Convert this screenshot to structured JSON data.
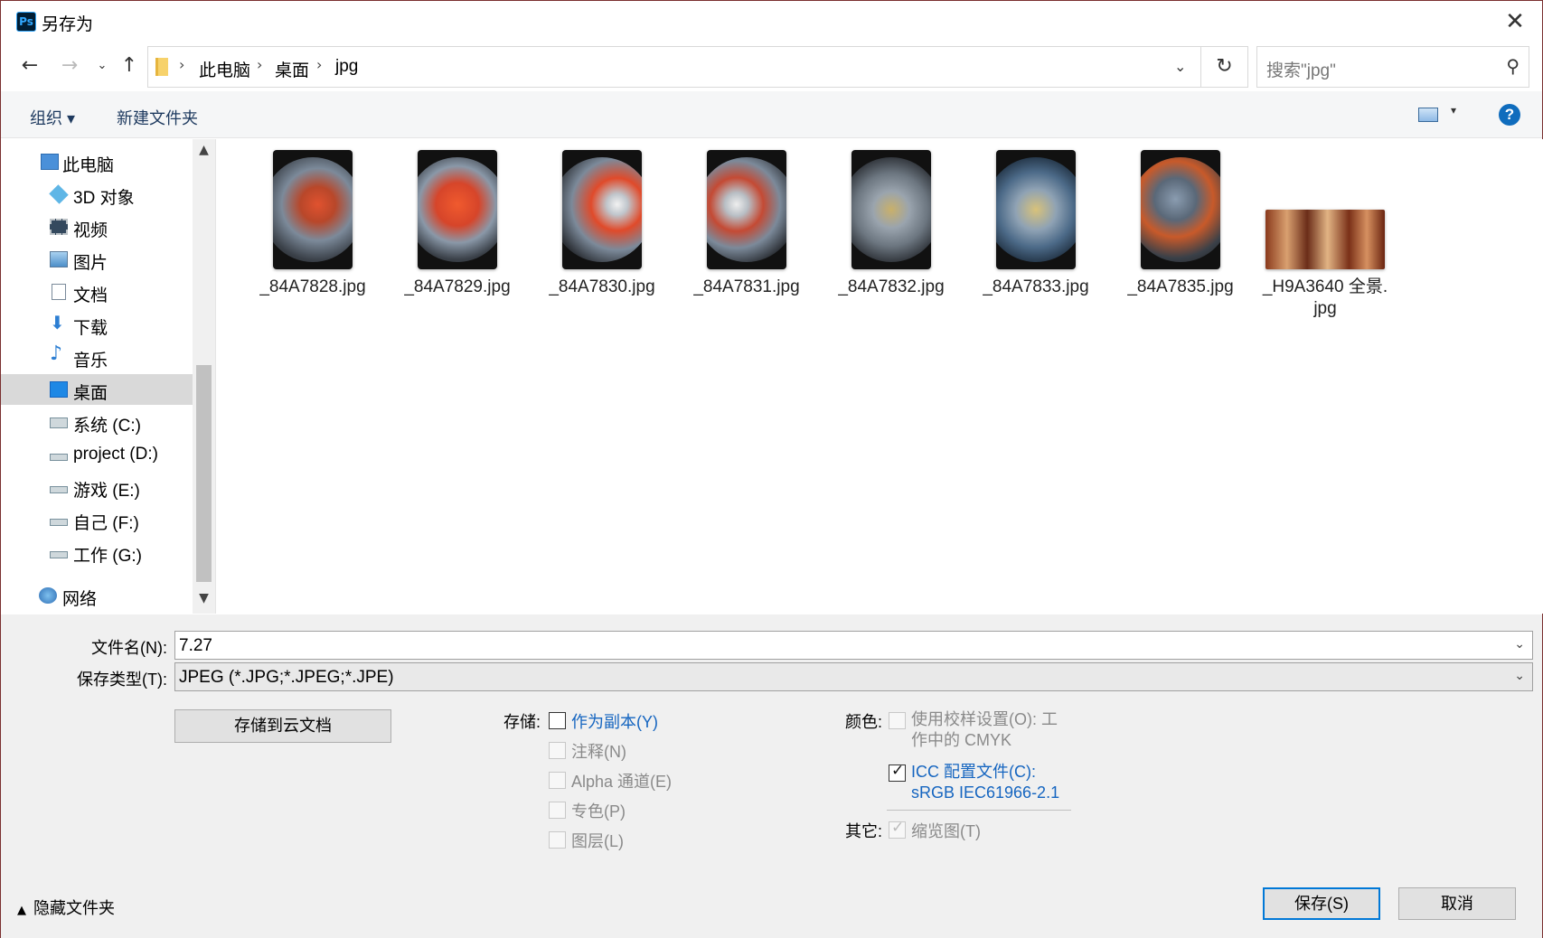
{
  "window": {
    "app_icon": "Ps",
    "title": "另存为",
    "close_icon": "✕"
  },
  "address": {
    "crumbs": [
      "此电脑",
      "桌面",
      "jpg"
    ],
    "search_placeholder": "搜索\"jpg\""
  },
  "toolbar": {
    "organize": "组织 ▾",
    "new_folder": "新建文件夹",
    "help": "?"
  },
  "sidebar": {
    "items": [
      {
        "label": "此电脑",
        "icon": "computer-icon"
      },
      {
        "label": "3D 对象",
        "icon": "cube-icon"
      },
      {
        "label": "视频",
        "icon": "video-icon"
      },
      {
        "label": "图片",
        "icon": "picture-icon"
      },
      {
        "label": "文档",
        "icon": "document-icon"
      },
      {
        "label": "下载",
        "icon": "download-icon"
      },
      {
        "label": "音乐",
        "icon": "music-icon"
      },
      {
        "label": "桌面",
        "icon": "desktop-icon",
        "selected": true
      },
      {
        "label": "系统 (C:)",
        "icon": "windows-drive-icon"
      },
      {
        "label": "project (D:)",
        "icon": "drive-icon"
      },
      {
        "label": "游戏 (E:)",
        "icon": "drive-icon"
      },
      {
        "label": "自己 (F:)",
        "icon": "drive-icon"
      },
      {
        "label": "工作 (G:)",
        "icon": "drive-icon"
      },
      {
        "label": "网络",
        "icon": "network-icon"
      }
    ]
  },
  "files": [
    {
      "name": "_84A7828.jpg"
    },
    {
      "name": "_84A7829.jpg"
    },
    {
      "name": "_84A7830.jpg"
    },
    {
      "name": "_84A7831.jpg"
    },
    {
      "name": "_84A7832.jpg"
    },
    {
      "name": "_84A7833.jpg"
    },
    {
      "name": "_84A7835.jpg"
    },
    {
      "name_line1": "_H9A3640 全景.",
      "name_line2": "jpg"
    }
  ],
  "form": {
    "filename_label": "文件名(N):",
    "filename_value": "7.27",
    "filetype_label": "保存类型(T):",
    "filetype_value": "JPEG (*.JPG;*.JPEG;*.JPE)",
    "cloud_button": "存储到云文档",
    "save_label": "存储:",
    "save_options": [
      {
        "label": "作为副本(Y)",
        "enabled": true,
        "checked": false
      },
      {
        "label": "注释(N)",
        "enabled": false,
        "checked": false
      },
      {
        "label": "Alpha 通道(E)",
        "enabled": false,
        "checked": false
      },
      {
        "label": "专色(P)",
        "enabled": false,
        "checked": false
      },
      {
        "label": "图层(L)",
        "enabled": false,
        "checked": false
      }
    ],
    "color_label": "颜色:",
    "proof_line1": "使用校样设置(O): 工",
    "proof_line2": "作中的 CMYK",
    "icc_line1": "ICC 配置文件(C):",
    "icc_line2": "sRGB IEC61966-2.1",
    "other_label": "其它:",
    "thumbnail": "缩览图(T)",
    "hide_folders": "隐藏文件夹",
    "save_button": "保存(S)",
    "cancel_button": "取消"
  }
}
